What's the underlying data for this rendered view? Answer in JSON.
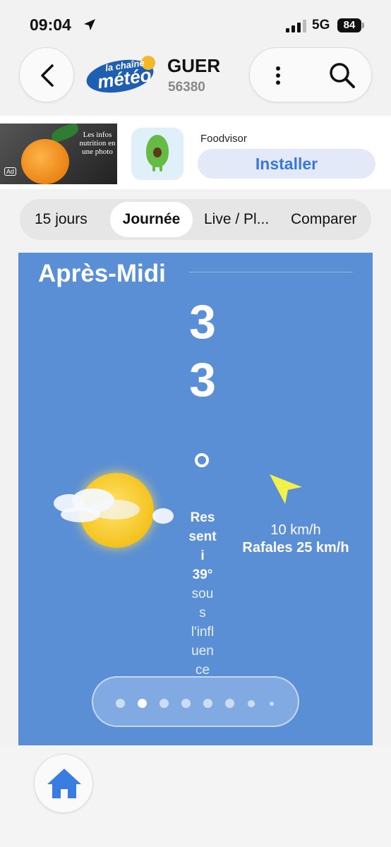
{
  "status_bar": {
    "time": "09:04",
    "network": "5G",
    "battery": "84"
  },
  "header": {
    "city": "GUER",
    "postal_code": "56380",
    "logo_text_top": "la chaîne",
    "logo_text_main": "météo"
  },
  "ad": {
    "image_text": "Les infos nutrition en une photo",
    "ad_tag": "Ad",
    "app_name": "Foodvisor",
    "install_label": "Installer"
  },
  "tabs": [
    {
      "label": "15 jours",
      "active": false
    },
    {
      "label": "Journée",
      "active": true
    },
    {
      "label": "Live / Pl...",
      "active": false
    },
    {
      "label": "Comparer",
      "active": false
    }
  ],
  "card": {
    "period": "Après-Midi",
    "temperature_digit_1": "3",
    "temperature_digit_2": "3",
    "feels_line1": "Res",
    "feels_line2": "sent",
    "feels_line3": "i",
    "feels_value": "39°",
    "feels_line4": "sou",
    "feels_line5": "s",
    "feels_line6": "l'infl",
    "feels_line7": "uen",
    "feels_line8": "ce",
    "wind_speed": "10 km/h",
    "wind_gusts": "Rafales 25 km/h",
    "background_color": "#5a8fd6",
    "weather_icon": "sun-partly-cloudy-icon"
  },
  "pager": {
    "total": 8,
    "active_index": 1
  },
  "bottom_nav": {
    "home_icon": "home-icon",
    "accent": "#3a7de0"
  }
}
